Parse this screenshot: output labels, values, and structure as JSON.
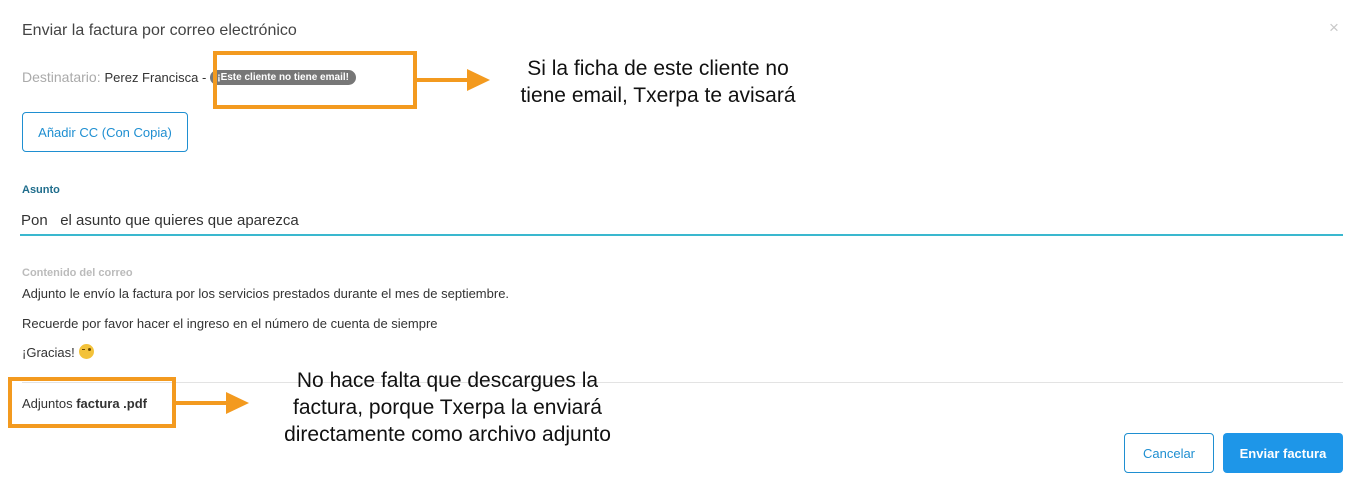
{
  "dialog": {
    "title": "Enviar la factura por correo electrónico",
    "close_glyph": "×",
    "recipient_label": "Destinatario:",
    "recipient_name": "Perez Francisca -",
    "no_email_badge": "¡Este cliente no tiene email!",
    "add_cc_label": "Añadir CC (Con Copia)",
    "subject_label": "Asunto",
    "subject_value": "Pon   el asunto que quieres que aparezca",
    "content_label": "Contenido del correo",
    "content_lines": [
      "Adjunto le envío la factura por los servicios prestados durante el mes de septiembre.",
      "Recuerde por favor hacer el ingreso en el número de cuenta de siempre",
      "¡Gracias!"
    ],
    "attachments_label": "Adjuntos",
    "attachment_file": "factura .pdf",
    "cancel_label": "Cancelar",
    "send_label": "Enviar factura"
  },
  "annotations": {
    "badge_note": [
      "Si la ficha de este cliente no",
      "tiene email, Txerpa te avisará"
    ],
    "attachment_note": [
      "No hace falta que descargues la",
      "factura, porque Txerpa la enviará",
      "directamente como archivo adjunto"
    ]
  },
  "colors": {
    "accent": "#1f8fd1",
    "send_button": "#1e96e8",
    "input_underline": "#3ab8cf",
    "highlight": "#f39a1f",
    "badge": "#777777"
  },
  "icons": {
    "close": "close-icon",
    "emoji": "winking-face-icon",
    "arrow": "arrow-right-icon"
  }
}
